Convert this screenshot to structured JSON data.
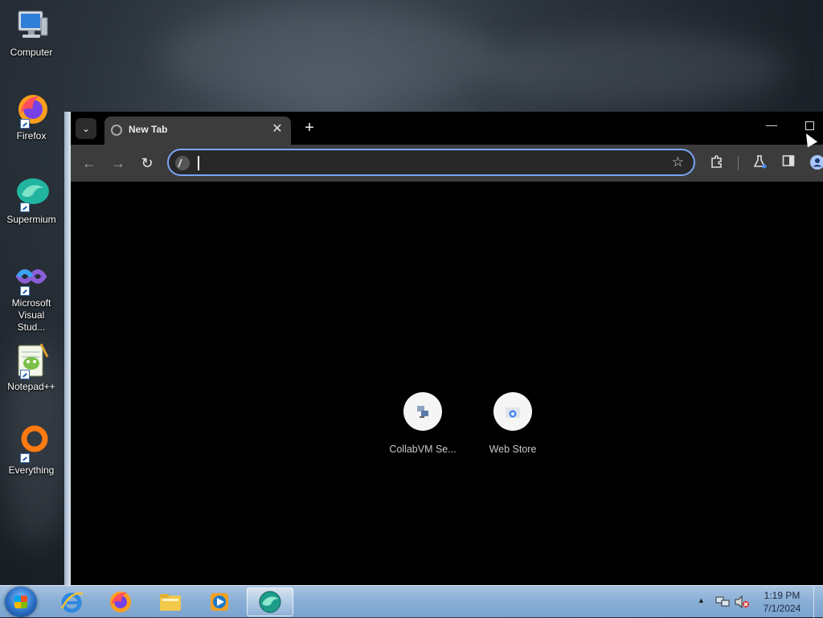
{
  "desktop": {
    "icons": [
      {
        "label": "Computer"
      },
      {
        "label": "Firefox"
      },
      {
        "label": "Supermium"
      },
      {
        "label": "Microsoft Visual Stud..."
      },
      {
        "label": "Notepad++"
      },
      {
        "label": "Everything"
      }
    ]
  },
  "browser": {
    "tab": {
      "title": "New Tab",
      "close_glyph": "✕"
    },
    "new_tab_glyph": "+",
    "minimize_glyph": "—",
    "toolbar": {
      "back_glyph": "←",
      "forward_glyph": "→",
      "reload_glyph": "↻",
      "address_value": "",
      "bookmark_glyph": "☆"
    },
    "shortcuts": [
      {
        "label": "CollabVM Se..."
      },
      {
        "label": "Web Store"
      }
    ]
  },
  "taskbar": {
    "clock_time": "1:19 PM",
    "clock_date": "7/1/2024",
    "tray_arrow_glyph": "▲"
  },
  "colors": {
    "omnibox_focus": "#7aa5f7",
    "toolbar_bg": "#3c3c3c",
    "tab_bg": "#3c3c3c"
  }
}
